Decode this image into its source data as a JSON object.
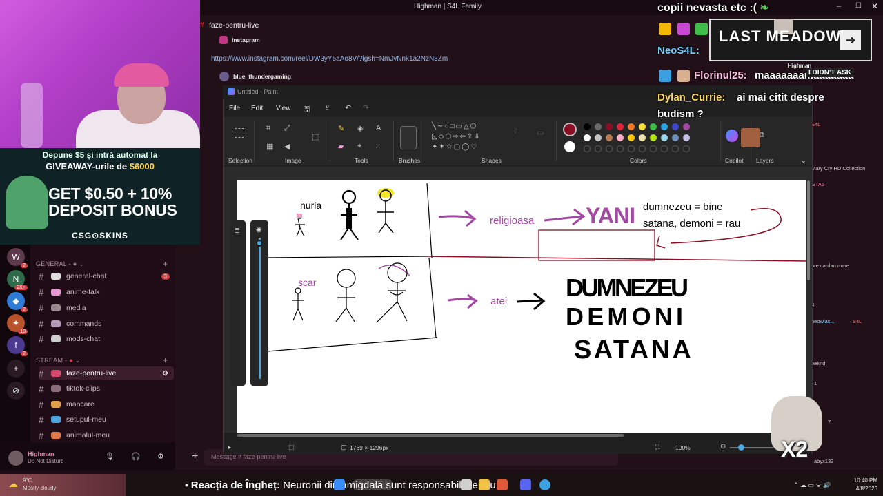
{
  "discord": {
    "window_title": "Highman | S4L Family",
    "channel_header": "faze-pentru-live",
    "messages": [
      {
        "user": "Instagram"
      },
      {
        "link": "https://www.instagram.com/reel/DW3yY5aAo8V/?igsh=NmJvNnk1a2NzN3Zm"
      },
      {
        "user": "blue_thundergaming"
      }
    ],
    "categories": [
      {
        "label": "GENERAL -"
      },
      {
        "label": "STREAM -"
      }
    ],
    "channels": [
      {
        "name": "general-chat",
        "badge": "3"
      },
      {
        "name": "anime-talk"
      },
      {
        "name": "media"
      },
      {
        "name": "commands"
      },
      {
        "name": "mods-chat"
      },
      {
        "name": "faze-pentru-live",
        "active": true
      },
      {
        "name": "tiktok-clips"
      },
      {
        "name": "mancare"
      },
      {
        "name": "setupul-meu"
      },
      {
        "name": "animalul-meu"
      }
    ],
    "server_badges": [
      "2",
      "2K+",
      "2",
      "10",
      "2"
    ],
    "user": {
      "name": "Highman",
      "status": "Do Not Disturb"
    },
    "input_placeholder": "Message # faze-pentru-live",
    "right_side_snippets": [
      "S4L",
      "Mary Cry HD Collection",
      "GTA6",
      "are cardan mare",
      "3",
      "neowlas...",
      "S4L",
      "eeknd",
      "1",
      "7",
      "abyx133"
    ]
  },
  "webcam_ad": {
    "top_line1": "Depune $5 și intră automat la",
    "top_line2_prefix": "GIVEAWAY-urile de ",
    "top_line2_amount": "$6000",
    "big_line1": "GET $0.50 + 10%",
    "big_line2": "DEPOSIT BONUS",
    "logo": "CSG⊙SKINS"
  },
  "twitch_chat": {
    "top_text": "copii nevasta etc :(",
    "emote_text": "LAST MEADOW",
    "emote_user": "Highman",
    "neo_name": "NeoS4L:",
    "florin_name": "Florinul25:",
    "florin_msg": "maaaaaaamaaaaaaa",
    "didnt_ask": "I DIDN'T ASK",
    "dylan_name": "Dylan_Currie:",
    "dylan_msg": "ai mai citit despre",
    "dylan_msg2": "budism ?",
    "sticker_label": "X2"
  },
  "paint": {
    "title": "Untitled - Paint",
    "menu": [
      "File",
      "Edit",
      "View"
    ],
    "ribbon_groups": [
      "Selection",
      "Image",
      "Tools",
      "Brushes",
      "Shapes",
      "Colors",
      "Copilot",
      "Layers"
    ],
    "primary_color": "#8b0f24",
    "secondary_color": "#ffffff",
    "palette": [
      "#000000",
      "#6b6b6b",
      "#8b0f24",
      "#e0263c",
      "#f27a2a",
      "#f7e03a",
      "#3fbf4a",
      "#2aa7e0",
      "#3f48cc",
      "#a349a4",
      "#ffffff",
      "#c3c3c3",
      "#b97a57",
      "#ffaec9",
      "#ffc90e",
      "#efe4b0",
      "#b5e61d",
      "#99d9ea",
      "#7092be",
      "#c8bfe7"
    ],
    "canvas_size": "1769 × 1296px",
    "zoom": "100%",
    "canvas_text": {
      "nuria": "nuria",
      "scar": "scar",
      "religioasa": "religioasa",
      "yani": "YANI",
      "dumnezeu_bine": "dumnezeu = bine",
      "satana_rau": "satana, demoni = rau",
      "atei": "atei",
      "big1": "DUMNEZEU",
      "big2": "DEMONI",
      "big3": "SATANA"
    }
  },
  "taskbar": {
    "weather_temp": "9°C",
    "weather_desc": "Mostly cloudy",
    "ticker_bold": "Reacția de Îngheț:",
    "ticker_rest": " Neuronii din amigdală sunt responsabili pentru",
    "time": "10:40 PM",
    "date": "4/8/2026"
  }
}
